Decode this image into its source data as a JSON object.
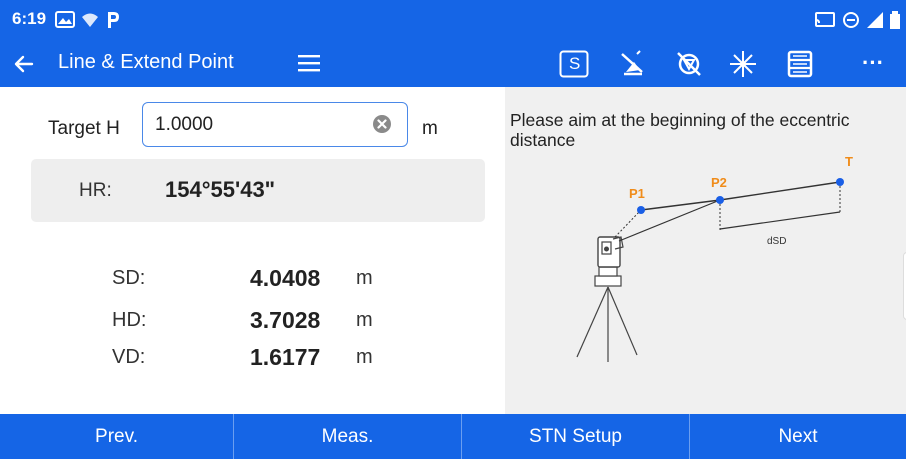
{
  "status_bar": {
    "time": "6:19",
    "icons": [
      "gallery-icon",
      "wifi-question-icon",
      "parking-p-icon",
      "cast-icon",
      "minus-circle-icon",
      "signal-icon",
      "battery-icon"
    ]
  },
  "app_bar": {
    "title": "Line & Extend Point",
    "s_button_label": "S",
    "more_label": "···"
  },
  "target": {
    "label": "Target H",
    "value": "1.0000",
    "unit": "m"
  },
  "hr": {
    "label": "HR:",
    "value": "154°55'43\""
  },
  "measurements": [
    {
      "label": "SD:",
      "value": "4.0408",
      "unit": "m"
    },
    {
      "label": "HD:",
      "value": "3.7028",
      "unit": "m"
    },
    {
      "label": "VD:",
      "value": "1.6177",
      "unit": "m"
    }
  ],
  "instruction": "Please aim at the beginning of the eccentric distance",
  "diagram": {
    "p1_label": "P1",
    "p2_label": "P2",
    "t_label": "T",
    "dsd_label": "dSD",
    "accent_color": "#f08c1a",
    "point_color": "#1a5fe6"
  },
  "bottom_bar": {
    "buttons": [
      "Prev.",
      "Meas.",
      "STN Setup",
      "Next"
    ]
  },
  "colors": {
    "primary": "#1565e6",
    "panel": "#f0f0f0"
  }
}
